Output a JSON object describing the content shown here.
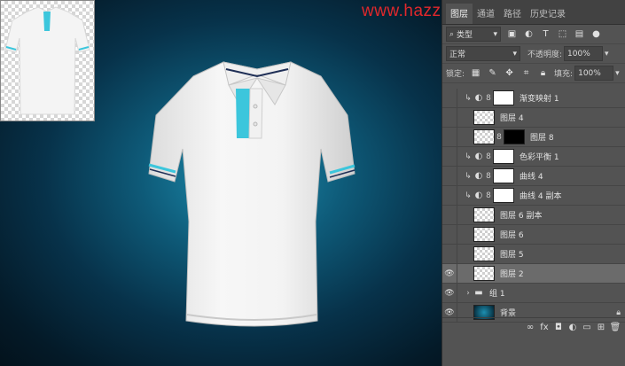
{
  "watermark": "www.hazzhandongde.com",
  "panel": {
    "tabs": [
      "图层",
      "通道",
      "路径",
      "历史记录"
    ],
    "filter": {
      "value": "类型"
    },
    "blend_mode": "正常",
    "opacity_label": "不透明度:",
    "opacity_value": "100%",
    "lock_label": "锁定:",
    "fill_label": "填充:",
    "fill_value": "100%",
    "layers": [
      {
        "name": "渐变映射 1",
        "visible": false,
        "selected": false,
        "clipped": true,
        "kind": "adjustment",
        "mask": "white"
      },
      {
        "name": "图层 4",
        "visible": false,
        "selected": false,
        "clipped": false,
        "kind": "pixel",
        "mask": ""
      },
      {
        "name": "图层 8",
        "visible": false,
        "selected": false,
        "clipped": false,
        "kind": "pixel",
        "mask": "black"
      },
      {
        "name": "色彩平衡 1",
        "visible": false,
        "selected": false,
        "clipped": true,
        "kind": "adjustment",
        "mask": "white"
      },
      {
        "name": "曲线 4",
        "visible": false,
        "selected": false,
        "clipped": true,
        "kind": "adjustment",
        "mask": "white"
      },
      {
        "name": "曲线 4 副本",
        "visible": false,
        "selected": false,
        "clipped": true,
        "kind": "adjustment",
        "mask": "white"
      },
      {
        "name": "图层 6 副本",
        "visible": false,
        "selected": false,
        "clipped": false,
        "kind": "pixel",
        "mask": ""
      },
      {
        "name": "图层 6",
        "visible": false,
        "selected": false,
        "clipped": false,
        "kind": "pixel",
        "mask": ""
      },
      {
        "name": "图层 5",
        "visible": false,
        "selected": false,
        "clipped": false,
        "kind": "pixel",
        "mask": ""
      },
      {
        "name": "图层 2",
        "visible": true,
        "selected": true,
        "clipped": false,
        "kind": "pixel",
        "mask": ""
      },
      {
        "name": "组 1",
        "visible": true,
        "selected": false,
        "clipped": false,
        "kind": "group",
        "mask": ""
      },
      {
        "name": "背景",
        "visible": true,
        "selected": false,
        "clipped": false,
        "kind": "background",
        "mask": ""
      }
    ],
    "bottom_icons": [
      "link-icon",
      "fx-icon",
      "mask-icon",
      "adjustment-icon",
      "folder-icon",
      "new-layer-icon",
      "trash-icon"
    ]
  }
}
